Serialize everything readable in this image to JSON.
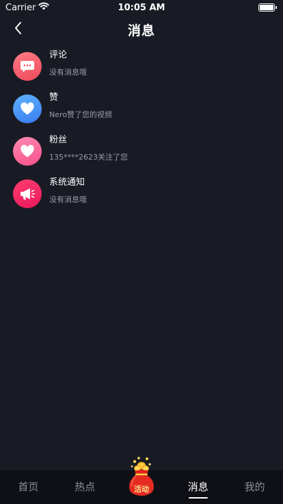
{
  "status_bar": {
    "carrier": "Carrier",
    "time": "10:05 AM"
  },
  "header": {
    "title": "消息",
    "back_icon": "chevron-left-icon"
  },
  "messages": [
    {
      "title": "评论",
      "subtitle": "没有消息哦",
      "icon": "comment-bubble-icon",
      "color": "#ee4a5c"
    },
    {
      "title": "赞",
      "subtitle": "Nero赞了您的视频",
      "icon": "heart-icon",
      "color": "#3a7cf0"
    },
    {
      "title": "粉丝",
      "subtitle": "135****2623关注了您",
      "icon": "heart-icon",
      "color": "#f5508a"
    },
    {
      "title": "系统通知",
      "subtitle": "没有消息哦",
      "icon": "megaphone-icon",
      "color": "#e8195c"
    }
  ],
  "tab_bar": {
    "tabs": [
      {
        "label": "首页",
        "active": false
      },
      {
        "label": "热点",
        "active": false
      },
      {
        "label": "",
        "active": false
      },
      {
        "label": "消息",
        "active": true
      },
      {
        "label": "我的",
        "active": false
      }
    ],
    "activity_label": "活动"
  },
  "colors": {
    "background": "#191b24",
    "tab_bar_background": "#0f1016",
    "text_primary": "#ffffff",
    "text_secondary": "#9a9ca6"
  }
}
